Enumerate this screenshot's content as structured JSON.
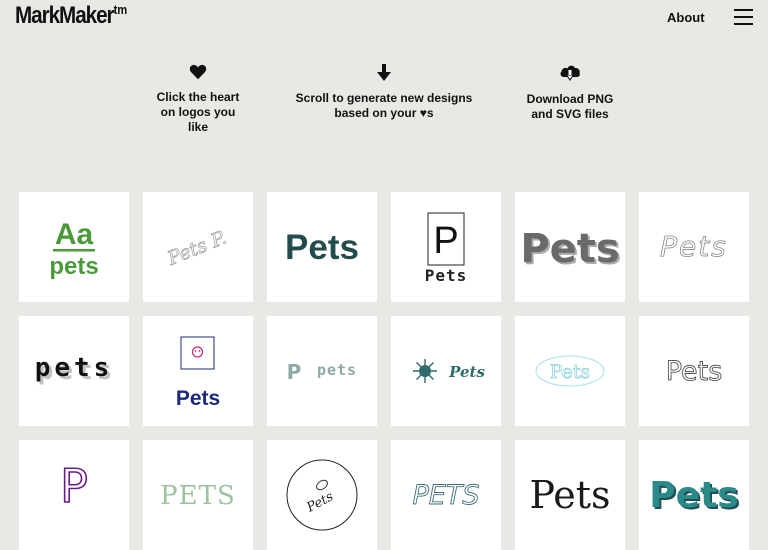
{
  "header": {
    "brand": "MarkMaker",
    "brand_mark": "tm",
    "about_label": "About",
    "menu_icon": "hamburger-menu-icon"
  },
  "steps": [
    {
      "icon": "heart-icon",
      "text": "Click the heart\non logos you\nlike"
    },
    {
      "icon": "arrow-down-icon",
      "text_before": "Scroll to generate new designs\nbased on your ",
      "heart": "♥",
      "text_after": "s"
    },
    {
      "icon": "cloud-download-icon",
      "text": "Download PNG\nand SVG files"
    }
  ],
  "logos": {
    "r1": {
      "t1": {
        "top": "Aa",
        "bottom": "pets"
      },
      "t2": {
        "text": "Pets P."
      },
      "t3": {
        "text": "Pets"
      },
      "t4": {
        "letter": "P",
        "text": "Pets"
      },
      "t5": {
        "text": "Pets"
      },
      "t6": {
        "text": "Pets"
      }
    },
    "r2": {
      "t1": {
        "text": "pets"
      },
      "t2": {
        "text": "Pets"
      },
      "t3": {
        "letter": "P",
        "text": "pets"
      },
      "t4": {
        "text": "Pets"
      },
      "t5": {
        "text": "Pets"
      },
      "t6": {
        "text": "Pets"
      }
    },
    "r3": {
      "t1": {
        "text": "P"
      },
      "t2": {
        "text": "PETS"
      },
      "t3": {
        "text": "Pets"
      },
      "t4": {
        "text": "PETS"
      },
      "t5": {
        "text": "Pets"
      },
      "t6": {
        "text": "Pets"
      }
    }
  },
  "colors": {
    "background": "#e9e8e4",
    "green": "#4a9a3a",
    "dark_teal": "#234d4d",
    "navy": "#1c2a7c",
    "purple": "#6a1a8c",
    "sage": "#9dc29f"
  }
}
